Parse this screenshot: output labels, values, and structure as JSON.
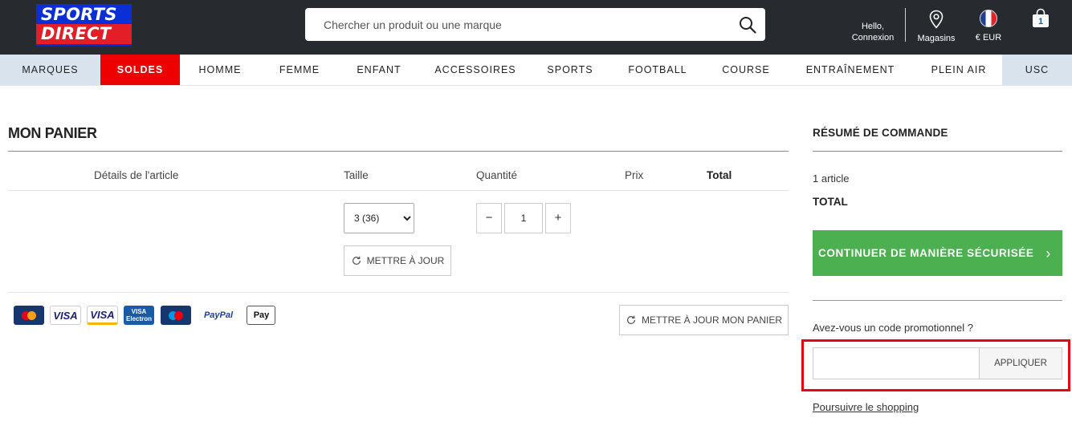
{
  "header": {
    "logo_line1": "SPORTS",
    "logo_line2": "DIRECT",
    "search_placeholder": "Chercher un produit ou une marque",
    "hello": "Hello,",
    "account": "Connexion",
    "stores": "Magasins",
    "currency": "€ EUR",
    "cart_count": "1"
  },
  "nav": {
    "items": [
      "MARQUES",
      "SOLDES",
      "HOMME",
      "FEMME",
      "ENFANT",
      "ACCESSOIRES",
      "SPORTS",
      "FOOTBALL",
      "COURSE",
      "ENTRAÎNEMENT",
      "PLEIN AIR",
      "USC"
    ]
  },
  "cart": {
    "title": "MON PANIER",
    "columns": {
      "details": "Détails de l'article",
      "size": "Taille",
      "quantity": "Quantité",
      "price": "Prix",
      "total": "Total"
    },
    "item": {
      "size_selected": "3 (36)",
      "quantity": "1",
      "decrement": "−",
      "increment": "+",
      "update_label": "METTRE À JOUR"
    },
    "update_cart_label": "METTRE À JOUR MON PANIER",
    "payments": {
      "visa": "VISA",
      "visa_electron_top": "VISA",
      "visa_electron_bottom": "Electron",
      "paypal": "PayPal",
      "apple_pay": "Pay"
    }
  },
  "summary": {
    "title": "RÉSUMÉ DE COMMANDE",
    "items_count": "1 article",
    "total_label": "TOTAL",
    "checkout_label": "CONTINUER DE MANIÈRE SÉCURISÉE",
    "promo_question": "Avez-vous un code promotionnel ?",
    "promo_value": "",
    "apply_label": "APPLIQUER",
    "continue_shopping": "Poursuivre le shopping"
  },
  "colors": {
    "header_bg": "#272a2e",
    "logo_blue": "#0a2fd6",
    "logo_red": "#e41e26",
    "sale_red": "#ee0000",
    "nav_alt_bg": "#d9e3ee",
    "checkout_green": "#4caf50",
    "highlight_red": "#e30613"
  },
  "icons": {
    "search": "search-icon",
    "stores": "map-pin-icon",
    "currency": "france-flag-icon",
    "cart": "shopping-bag-icon",
    "refresh": "refresh-icon",
    "chevron": "chevron-right-icon"
  }
}
